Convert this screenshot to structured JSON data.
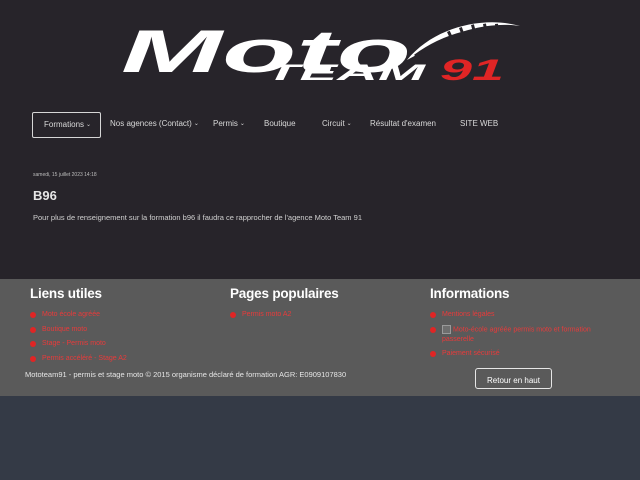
{
  "colors": {
    "header_bg": "#27242a",
    "footer_bg": "#5a5a5a",
    "page_bg": "#343a46",
    "accent_red": "#e02525",
    "logo_white": "#ffffff"
  },
  "logo": {
    "moto_text": "Moto",
    "team_text": "TEAM",
    "number_text": "91"
  },
  "nav": {
    "items": [
      {
        "label": "Formations",
        "dropdown": true,
        "active": true
      },
      {
        "label": "Nos agences (Contact)",
        "dropdown": true
      },
      {
        "label": "Permis",
        "dropdown": true
      },
      {
        "label": "Boutique",
        "dropdown": false
      },
      {
        "label": "Circuit",
        "dropdown": true
      },
      {
        "label": "Résultat d'examen",
        "dropdown": false
      },
      {
        "label": "SITE WEB",
        "dropdown": false
      }
    ],
    "caret_icon": "chevron-down-icon"
  },
  "article": {
    "date": "samedi, 15 juillet 2023 14:18",
    "title": "B96",
    "body": "Pour plus de renseignement sur la formation b96 il faudra ce rapprocher de l'agence Moto Team 91"
  },
  "footer": {
    "links_title": "Liens utiles",
    "links": [
      "Moto école agréée",
      "Boutique moto",
      "Stage - Permis moto",
      "Permis accéléré - Stage A2"
    ],
    "popular_title": "Pages populaires",
    "popular": [
      "Permis moto A2"
    ],
    "info_title": "Informations",
    "info": [
      "Mentions légales",
      "Moto-école agréée permis moto et formation passerelle",
      "Paiement sécurisé"
    ],
    "copyright": "Mototeam91 - permis et stage moto © 2015 organisme déclaré de formation AGR: E0909107830",
    "back_to_top": "Retour en haut"
  }
}
